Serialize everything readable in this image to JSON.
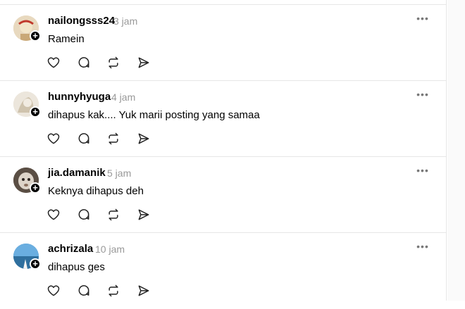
{
  "posts": [
    {
      "username": "nailongsss24",
      "time": "3 jam",
      "text": "Ramein",
      "avatar_color": "#d9c7a8",
      "avatar_accent": "#c0392b"
    },
    {
      "username": "hunnyhyuga",
      "time": "4 jam",
      "text": "dihapus kak.... Yuk marii posting yang samaa",
      "avatar_color": "#e6ddd0",
      "avatar_accent": "#b8a98f"
    },
    {
      "username": "jia.damanik",
      "time": "5 jam",
      "text": "Keknya dihapus deh",
      "avatar_color": "#6b5e52",
      "avatar_accent": "#d8d1c8"
    },
    {
      "username": "achrizala",
      "time": "10 jam",
      "text": "dihapus ges",
      "avatar_color": "#4a8fc4",
      "avatar_accent": "#1e4f78"
    }
  ],
  "icons": {
    "more": "more-options-icon",
    "like": "heart-icon",
    "reply": "comment-icon",
    "repost": "repost-icon",
    "share": "send-icon",
    "follow": "plus-icon"
  },
  "more_glyph": "•••",
  "plus_glyph": "+"
}
